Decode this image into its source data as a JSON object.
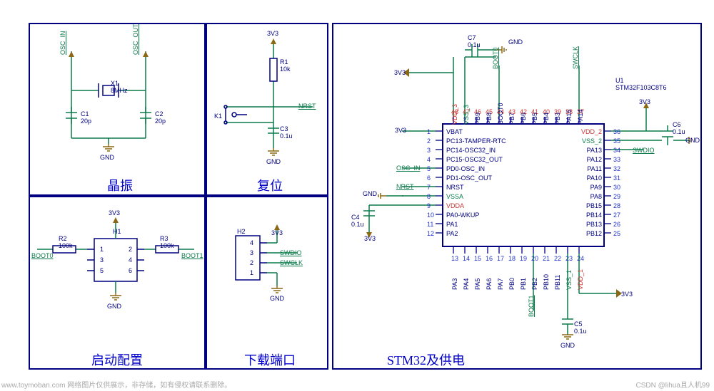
{
  "sections": {
    "osc": {
      "title": "晶振",
      "x1_ref": "X1",
      "x1_val": "8MHz",
      "c1_ref": "C1",
      "c1_val": "20p",
      "c2_ref": "C2",
      "c2_val": "20p",
      "net_in": "OSC_IN",
      "net_out": "OSC_OUT",
      "pwr_gnd": "GND"
    },
    "reset": {
      "title": "复位",
      "r1_ref": "R1",
      "r1_val": "10k",
      "c3_ref": "C3",
      "c3_val": "0.1u",
      "k1_ref": "K1",
      "net_3v3": "3V3",
      "net_nrst": "NRST",
      "pwr_gnd": "GND"
    },
    "boot": {
      "title": "启动配置",
      "h1_ref": "H1",
      "r2_ref": "R2",
      "r2_val": "100k",
      "r3_ref": "R3",
      "r3_val": "100k",
      "net_3v3": "3V3",
      "net_boot0": "BOOT0",
      "net_boot1": "BOOT1",
      "pwr_gnd": "GND",
      "pins": [
        "1",
        "3",
        "5",
        "2",
        "4",
        "6"
      ]
    },
    "swd": {
      "title": "下载端口",
      "h2_ref": "H2",
      "net_3v3": "3V3",
      "net_swdio": "SWDIO",
      "net_swclk": "SWCLK",
      "pwr_gnd": "GND",
      "pins": [
        "4",
        "3",
        "2",
        "1"
      ]
    },
    "mcu": {
      "title": "STM32及供电",
      "u1_ref": "U1",
      "u1_val": "STM32F103C8T6",
      "c4_ref": "C4",
      "c4_val": "0.1u",
      "c5_ref": "C5",
      "c5_val": "0.1u",
      "c6_ref": "C6",
      "c6_val": "0.1u",
      "c7_ref": "C7",
      "c7_val": "0.1u",
      "vdd2": "VDD_2",
      "vss2": "VSS_2",
      "vdd3": "VDD_3",
      "vss3": "VSS_3",
      "vdd1": "VDD_1",
      "vss1": "VSS_1",
      "net_3v3": "3V3",
      "pwr_gnd": "GND",
      "net_osc_in": "OSC_IN",
      "net_nrst": "NRST",
      "net_boot0": "BOOT0",
      "net_boot1": "BOOT1",
      "net_swdio": "SWDIO",
      "net_swclk": "SWCLK",
      "left_pins": [
        {
          "n": "1",
          "name": "VBAT"
        },
        {
          "n": "2",
          "name": "PC13-TAMPER-RTC"
        },
        {
          "n": "3",
          "name": "PC14-OSC32_IN"
        },
        {
          "n": "4",
          "name": "PC15-OSC32_OUT"
        },
        {
          "n": "5",
          "name": "PD0-OSC_IN"
        },
        {
          "n": "6",
          "name": "PD1-OSC_OUT"
        },
        {
          "n": "7",
          "name": "NRST"
        },
        {
          "n": "8",
          "name": "VSSA"
        },
        {
          "n": "9",
          "name": "VDDA"
        },
        {
          "n": "10",
          "name": "PA0-WKUP"
        },
        {
          "n": "11",
          "name": "PA1"
        },
        {
          "n": "12",
          "name": "PA2"
        }
      ],
      "right_pins": [
        {
          "n": "36",
          "name": "VDD_2"
        },
        {
          "n": "35",
          "name": "VSS_2"
        },
        {
          "n": "34",
          "name": "PA13"
        },
        {
          "n": "33",
          "name": "PA12"
        },
        {
          "n": "32",
          "name": "PA11"
        },
        {
          "n": "31",
          "name": "PA10"
        },
        {
          "n": "30",
          "name": "PA9"
        },
        {
          "n": "29",
          "name": "PA8"
        },
        {
          "n": "28",
          "name": "PB15"
        },
        {
          "n": "27",
          "name": "PB14"
        },
        {
          "n": "26",
          "name": "PB13"
        },
        {
          "n": "25",
          "name": "PB12"
        }
      ],
      "top_pins": [
        {
          "n": "48",
          "name": "VDD_3"
        },
        {
          "n": "47",
          "name": "VSS_3"
        },
        {
          "n": "46",
          "name": "PB9"
        },
        {
          "n": "45",
          "name": "PB8"
        },
        {
          "n": "44",
          "name": "BOOT0"
        },
        {
          "n": "43",
          "name": "PB7"
        },
        {
          "n": "42",
          "name": "PB6"
        },
        {
          "n": "41",
          "name": "PB5"
        },
        {
          "n": "40",
          "name": "PB4"
        },
        {
          "n": "39",
          "name": "PB3"
        },
        {
          "n": "38",
          "name": "PA15"
        },
        {
          "n": "37",
          "name": "PA14"
        }
      ],
      "bot_pins": [
        {
          "n": "13",
          "name": "PA3"
        },
        {
          "n": "14",
          "name": "PA4"
        },
        {
          "n": "15",
          "name": "PA5"
        },
        {
          "n": "16",
          "name": "PA6"
        },
        {
          "n": "17",
          "name": "PA7"
        },
        {
          "n": "18",
          "name": "PB0"
        },
        {
          "n": "19",
          "name": "PB1"
        },
        {
          "n": "20",
          "name": "PB2"
        },
        {
          "n": "21",
          "name": "PB10"
        },
        {
          "n": "22",
          "name": "PB11"
        },
        {
          "n": "23",
          "name": "VSS_1"
        },
        {
          "n": "24",
          "name": "VDD_1"
        }
      ]
    }
  },
  "watermarks": {
    "left": "www.toymoban.com  网络图片仅供展示，非存储，如有侵权请联系删除。",
    "right": "CSDN @lihua且人机99"
  }
}
